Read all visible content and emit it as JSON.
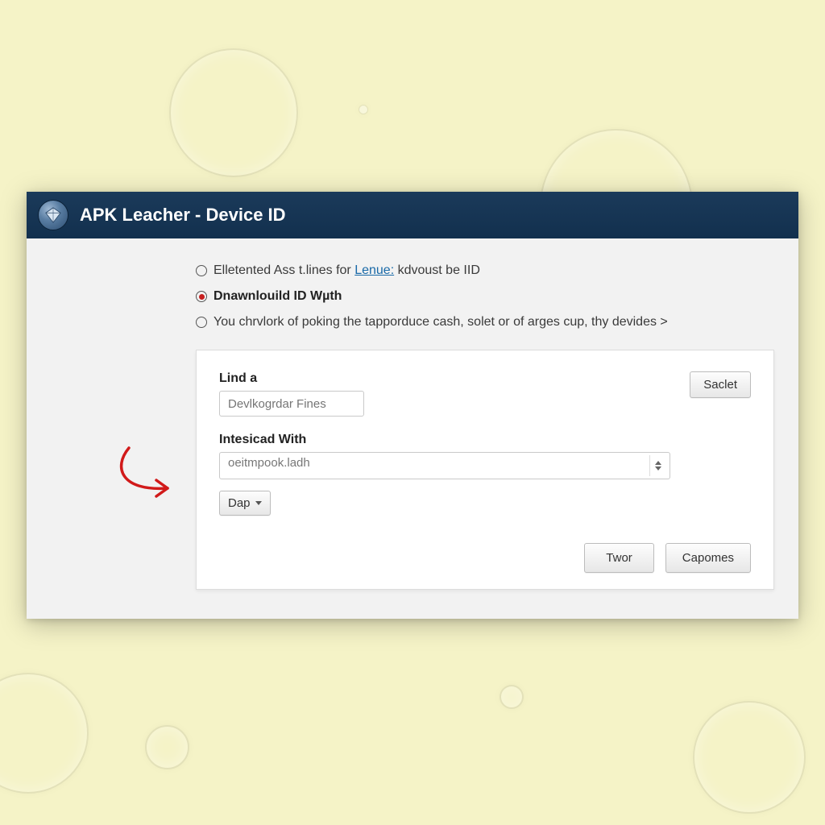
{
  "window": {
    "title": "APK Leacher - Device ID"
  },
  "radios": {
    "opt1_prefix": "Elletented Ass t.lines for ",
    "opt1_link": "Lenue:",
    "opt1_suffix": " kdvoust be IID",
    "opt2": "Dnawnlouild ID Wµth",
    "opt3": "You chrvlork of poking the tapporduce cash, solet or of arges cup, thy devides >"
  },
  "panel": {
    "field1_label": "Lind a",
    "field1_placeholder": "Devlkogrdar Fines",
    "field2_label": "Intesicad With",
    "field2_value": "oeitmpook.ladh",
    "btn_dap": "Dap",
    "btn_saclet": "Saclet",
    "btn_twor": "Twor",
    "btn_capomes": "Capomes"
  }
}
